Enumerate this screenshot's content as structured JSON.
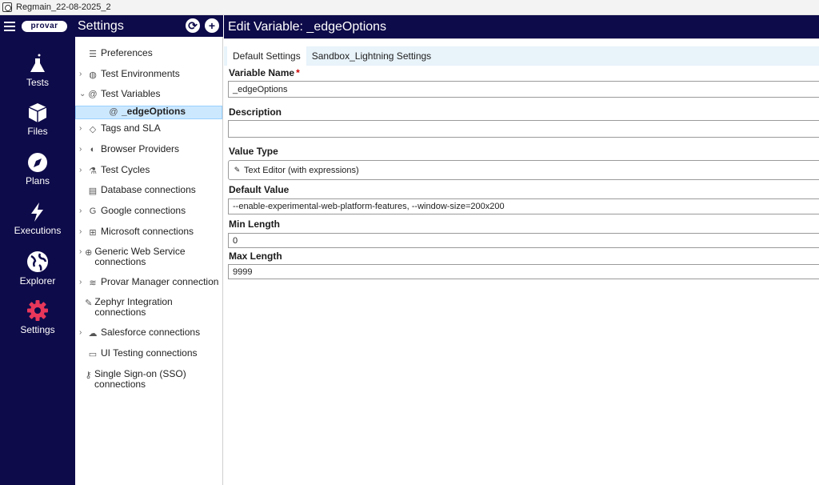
{
  "window": {
    "title": "Regmain_22-08-2025_2"
  },
  "rail": {
    "logo": "provar",
    "items": [
      {
        "label": "Tests",
        "icon": "flask-icon"
      },
      {
        "label": "Files",
        "icon": "cube-icon"
      },
      {
        "label": "Plans",
        "icon": "compass-icon"
      },
      {
        "label": "Executions",
        "icon": "lightning-icon"
      },
      {
        "label": "Explorer",
        "icon": "globe-icon"
      },
      {
        "label": "Settings",
        "icon": "gear-icon"
      }
    ],
    "active_color": "#e8375a"
  },
  "panel": {
    "title": "Settings",
    "refresh_glyph": "⟳",
    "add_glyph": "+",
    "tree": [
      {
        "label": "Preferences",
        "icon": "sliders-icon",
        "chevron": ""
      },
      {
        "label": "Test Environments",
        "icon": "environment-icon",
        "chevron": "›"
      },
      {
        "label": "Test Variables",
        "icon": "at-icon",
        "chevron": "⌄"
      },
      {
        "label": "_edgeOptions",
        "icon": "at-icon",
        "chevron": ""
      },
      {
        "label": "Tags and SLA",
        "icon": "tag-icon",
        "chevron": "›"
      },
      {
        "label": "Browser Providers",
        "icon": "browser-icon",
        "chevron": "›"
      },
      {
        "label": "Test Cycles",
        "icon": "flask-icon",
        "chevron": "›"
      },
      {
        "label": "Database connections",
        "icon": "database-icon",
        "chevron": ""
      },
      {
        "label": "Google connections",
        "icon": "google-icon",
        "chevron": "›"
      },
      {
        "label": "Microsoft connections",
        "icon": "microsoft-icon",
        "chevron": "›"
      },
      {
        "label": "Generic Web Service connections",
        "icon": "web-icon",
        "chevron": "›"
      },
      {
        "label": "Provar Manager connection",
        "icon": "layers-icon",
        "chevron": "›"
      },
      {
        "label": "Zephyr Integration connections",
        "icon": "zephyr-icon",
        "chevron": ""
      },
      {
        "label": "Salesforce connections",
        "icon": "cloud-icon",
        "chevron": "›"
      },
      {
        "label": "UI Testing connections",
        "icon": "monitor-icon",
        "chevron": ""
      },
      {
        "label": "Single Sign-on (SSO) connections",
        "icon": "key-icon",
        "chevron": ""
      }
    ],
    "selected_color": "#cce8ff"
  },
  "main": {
    "title": "Edit Variable: _edgeOptions",
    "tabs": [
      "Default Settings",
      "Sandbox_Lightning Settings"
    ],
    "fields": {
      "variable_name": {
        "label": "Variable Name",
        "required": "*",
        "value": "_edgeOptions"
      },
      "description": {
        "label": "Description",
        "value": ""
      },
      "value_type": {
        "label": "Value Type",
        "value": "Text Editor (with expressions)"
      },
      "default_value": {
        "label": "Default Value",
        "value": "--enable-experimental-web-platform-features, --window-size=200x200"
      },
      "min_length": {
        "label": "Min Length",
        "value": "0"
      },
      "max_length": {
        "label": "Max Length",
        "value": "9999"
      }
    }
  },
  "colors": {
    "header_bg": "#0e0b4a",
    "tab_strip_bg": "#e8f3fa"
  }
}
